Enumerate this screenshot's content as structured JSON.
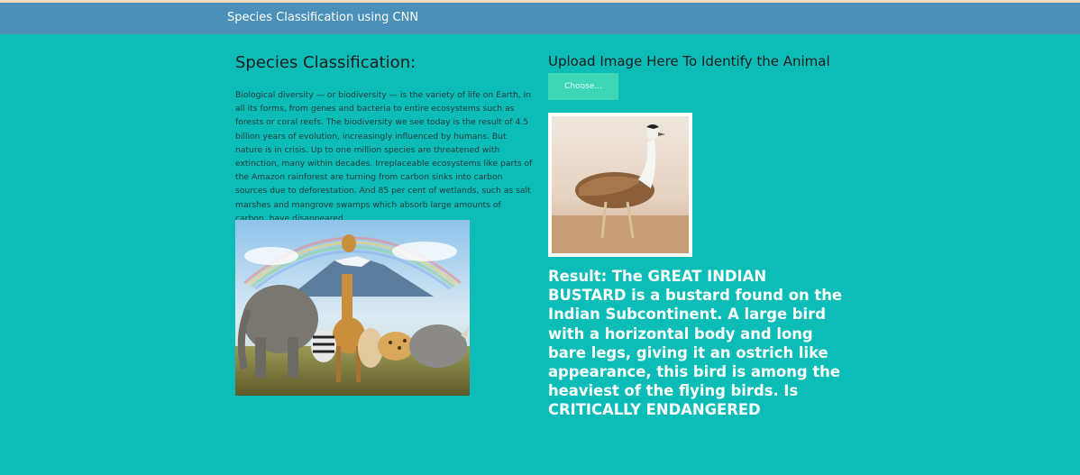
{
  "navbar": {
    "brand": "Species Classification using CNN"
  },
  "intro": {
    "title": "Species Classification:",
    "description": "Biological diversity — or biodiversity — is the variety of life on Earth, in all its forms, from genes and bacteria to entire ecosystems such as forests or coral reefs. The biodiversity we see today is the result of 4.5 billion years of evolution, increasingly influenced by humans. But nature is in crisis. Up to one million species are threatened with extinction, many within decades. Irreplaceable ecosystems like parts of the Amazon rainforest are turning from carbon sinks into carbon sources due to deforestation. And 85 per cent of wetlands, such as salt marshes and mangrove swamps which absorb large amounts of carbon, have disappeared."
  },
  "upload": {
    "heading": "Upload Image Here To Identify the Animal",
    "button_label": "Choose..."
  },
  "result": {
    "text": "Result: The GREAT INDIAN BUSTARD is a bustard found on the Indian Subcontinent. A large bird with a horizontal body and long bare legs, giving it an ostrich like appearance, this bird is among the heaviest of the flying birds. Is CRITICALLY ENDANGERED"
  },
  "colors": {
    "page_bg": "#0cbcb6",
    "navbar_bg": "#4a90b8",
    "button_bg": "#3dd6b7"
  }
}
